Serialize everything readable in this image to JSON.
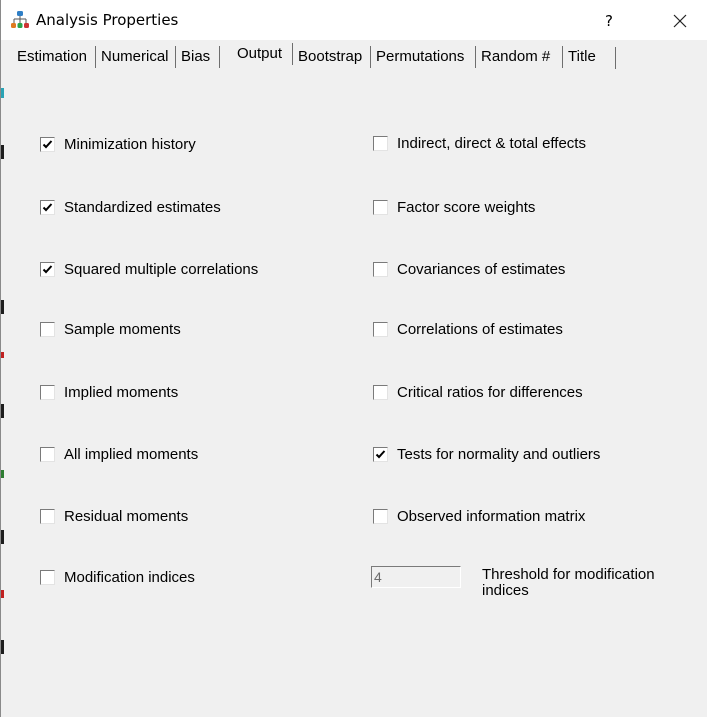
{
  "window": {
    "title": "Analysis Properties",
    "help_glyph": "?",
    "app_icon": "network-diagram-icon",
    "close_icon": "close-icon"
  },
  "tabs": [
    {
      "label": "Estimation"
    },
    {
      "label": "Numerical"
    },
    {
      "label": "Bias"
    },
    {
      "label": "Output",
      "active": true
    },
    {
      "label": "Bootstrap"
    },
    {
      "label": "Permutations"
    },
    {
      "label": "Random #"
    },
    {
      "label": "Title"
    }
  ],
  "left_options": [
    {
      "label": "Minimization history",
      "checked": true
    },
    {
      "label": "Standardized estimates",
      "checked": true
    },
    {
      "label": "Squared multiple correlations",
      "checked": true
    },
    {
      "label": "Sample moments",
      "checked": false
    },
    {
      "label": "Implied moments",
      "checked": false
    },
    {
      "label": "All implied moments",
      "checked": false
    },
    {
      "label": "Residual moments",
      "checked": false
    },
    {
      "label": "Modification indices",
      "checked": false
    }
  ],
  "right_options": [
    {
      "label": "Indirect, direct & total effects",
      "checked": false
    },
    {
      "label": "Factor score weights",
      "checked": false
    },
    {
      "label": "Covariances of estimates",
      "checked": false
    },
    {
      "label": "Correlations of estimates",
      "checked": false
    },
    {
      "label": "Critical ratios for differences",
      "checked": false
    },
    {
      "label": "Tests for normality and outliers",
      "checked": true
    },
    {
      "label": "Observed information matrix",
      "checked": false
    }
  ],
  "threshold": {
    "value": "4",
    "label_line1": "Threshold for modification",
    "label_line2": "indices"
  }
}
